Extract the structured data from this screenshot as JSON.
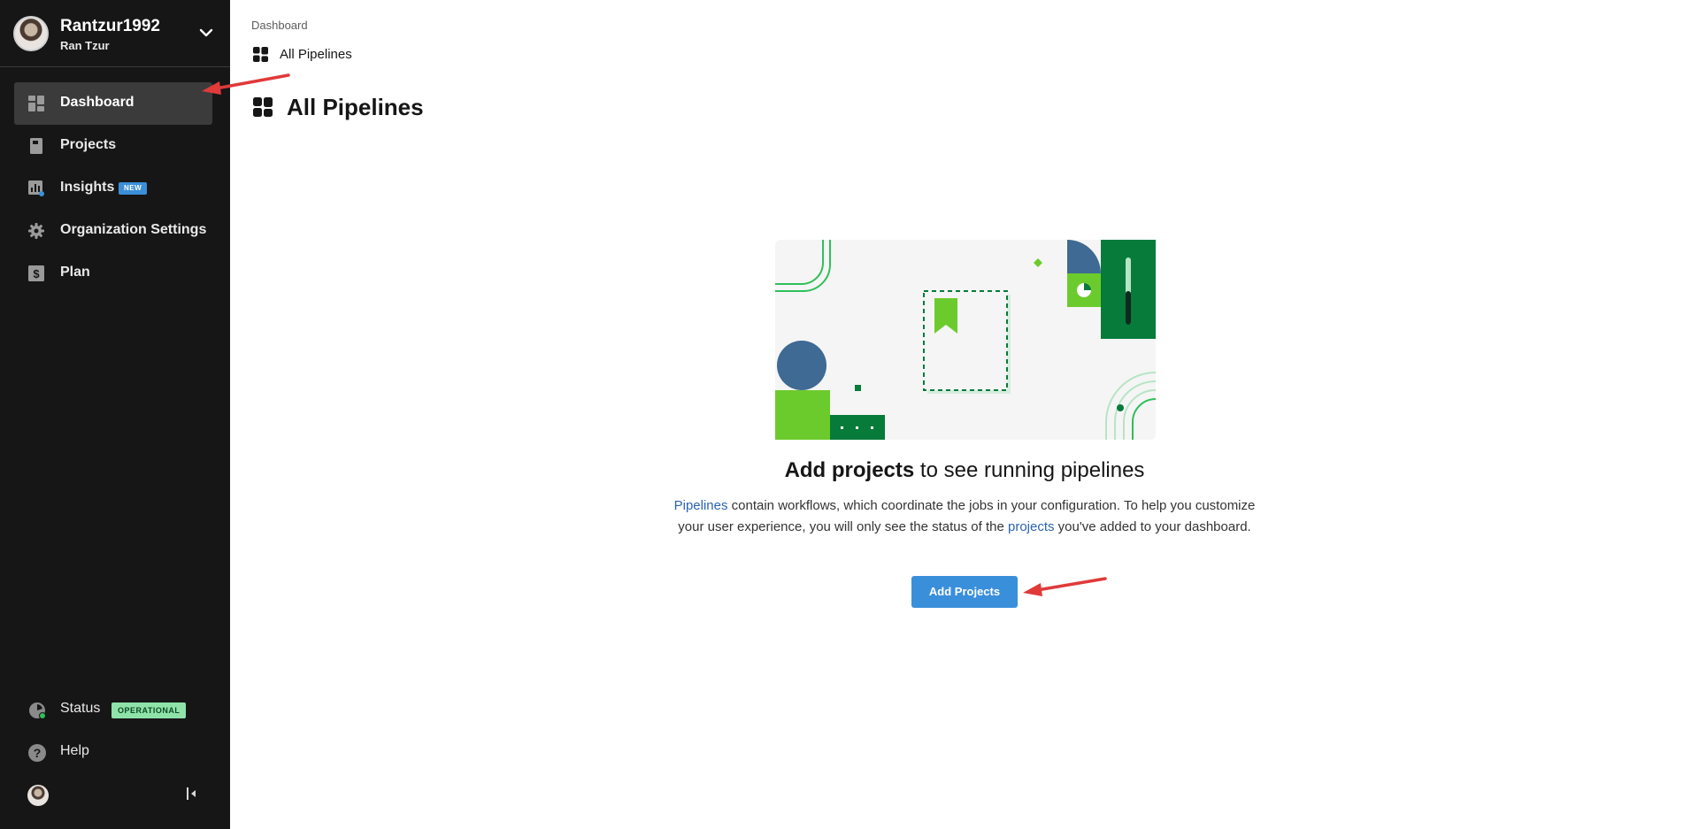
{
  "sidebar": {
    "org_name": "Rantzur1992",
    "user_name": "Ran Tzur",
    "nav_items": [
      {
        "label": "Dashboard",
        "icon": "dashboard-icon",
        "active": true
      },
      {
        "label": "Projects",
        "icon": "projects-icon"
      },
      {
        "label": "Insights",
        "icon": "insights-icon",
        "badge": "NEW"
      },
      {
        "label": "Organization Settings",
        "icon": "gear-icon"
      },
      {
        "label": "Plan",
        "icon": "dollar-icon"
      }
    ],
    "bottom": {
      "status_label": "Status",
      "status_badge": "OPERATIONAL",
      "help_label": "Help"
    }
  },
  "main": {
    "breadcrumb": "Dashboard",
    "breadcrumb_page": "All Pipelines",
    "title": "All Pipelines",
    "empty_state": {
      "heading_bold": "Add projects",
      "heading_rest": " to see running pipelines",
      "desc_link1": "Pipelines",
      "desc_part1": " contain workflows, which coordinate the jobs in your configuration. To help you customize your user experience, you will only see the status of the ",
      "desc_link2": "projects",
      "desc_part2": " you've added to your dashboard.",
      "button": "Add Projects"
    }
  },
  "colors": {
    "sidebar_bg": "#161616",
    "accent_blue": "#3a8fdb",
    "link_blue": "#2b64b2",
    "operational_green": "#8fe3a9",
    "annotation_red": "#e03a3a"
  }
}
